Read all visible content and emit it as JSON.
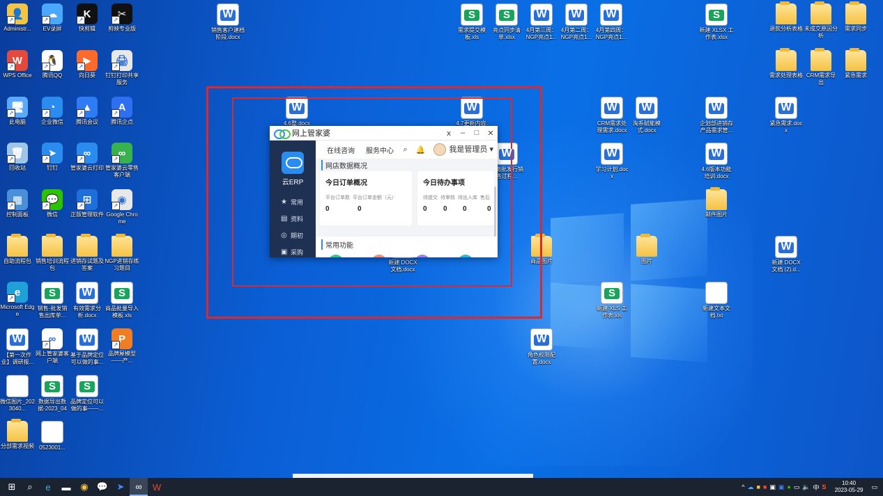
{
  "desktop": {
    "icons": [
      {
        "label": "Administr...",
        "kind": "app",
        "glyph": "👤",
        "color": "#f4c542"
      },
      {
        "label": "EV录屏",
        "kind": "app",
        "glyph": "☁",
        "color": "#4aa8ff"
      },
      {
        "label": "快剪辑",
        "kind": "app",
        "glyph": "K",
        "color": "#111111"
      },
      {
        "label": "剪映专业版",
        "kind": "app",
        "glyph": "✂",
        "color": "#111111"
      },
      {
        "label": "WPS Office",
        "kind": "app",
        "glyph": "W",
        "color": "#e24a3b"
      },
      {
        "label": "腾讯QQ",
        "kind": "app",
        "glyph": "🐧",
        "color": "#ffffff"
      },
      {
        "label": "向日葵",
        "kind": "app",
        "glyph": "▶",
        "color": "#ff6a2b"
      },
      {
        "label": "钉钉打印共享服务",
        "kind": "app",
        "glyph": "🖨",
        "color": "#e8e8e8"
      },
      {
        "label": "此电脑",
        "kind": "app",
        "glyph": "🖥",
        "color": "#5aa9ff"
      },
      {
        "label": "企业微信",
        "kind": "app",
        "glyph": "◔",
        "color": "#2b8cf0"
      },
      {
        "label": "腾讯会议",
        "kind": "app",
        "glyph": "▲",
        "color": "#2f7bf6"
      },
      {
        "label": "腾讯企点",
        "kind": "app",
        "glyph": "A",
        "color": "#2d6ff0"
      },
      {
        "label": "回收站",
        "kind": "app",
        "glyph": "🗑",
        "color": "#9fc6e8"
      },
      {
        "label": "钉钉",
        "kind": "app",
        "glyph": "➤",
        "color": "#2b8cf0"
      },
      {
        "label": "管家婆云打印",
        "kind": "app",
        "glyph": "∞",
        "color": "#2b8cf0"
      },
      {
        "label": "管家婆云零售客户端",
        "kind": "app",
        "glyph": "∞",
        "color": "#37b24d"
      },
      {
        "label": "控制面板",
        "kind": "app",
        "glyph": "▦",
        "color": "#4a90d9"
      },
      {
        "label": "微信",
        "kind": "app",
        "glyph": "💬",
        "color": "#2dc100"
      },
      {
        "label": "正版管理软件",
        "kind": "app",
        "glyph": "⊞",
        "color": "#1e6fd9"
      },
      {
        "label": "Google Chrome",
        "kind": "app",
        "glyph": "◉",
        "color": "#e8e8e8"
      },
      {
        "label": "自助流程包",
        "kind": "folder"
      },
      {
        "label": "销售培训流程包",
        "kind": "folder"
      },
      {
        "label": "进销存试题及答案",
        "kind": "folder"
      },
      {
        "label": "NGP进销存练习题目",
        "kind": "folder"
      },
      {
        "label": "Microsoft Edge",
        "kind": "app",
        "glyph": "e",
        "color": "#1fa0d8"
      },
      {
        "label": "销售-批发销售出库单...",
        "kind": "xls"
      },
      {
        "label": "有效需求分析.docx",
        "kind": "word"
      },
      {
        "label": "商品批量导入模板.xls",
        "kind": "xls"
      },
      {
        "label": "【第一次作业】调研报...",
        "kind": "word"
      },
      {
        "label": "网上管家婆客户端",
        "kind": "app",
        "glyph": "∞",
        "color": "#ffffff"
      },
      {
        "label": "基于品牌定位可以做的事...",
        "kind": "word"
      },
      {
        "label": "品牌屋模型——产...",
        "kind": "app",
        "glyph": "P",
        "color": "#f07c24"
      },
      {
        "label": "微信图片_2023040...",
        "kind": "txt"
      },
      {
        "label": "数据导出数据-2023_04_...",
        "kind": "xls"
      },
      {
        "label": "品牌定位可以做的事——...",
        "kind": "xls"
      },
      {
        "label": "分部需求视频",
        "kind": "folder"
      },
      {
        "label": "0523001...",
        "kind": "txt"
      },
      {
        "label": "销售客户建档阶段.docx",
        "kind": "word"
      },
      {
        "label": "需求提交模板.xls",
        "kind": "xls"
      },
      {
        "label": "亮点同步清单.xlsx",
        "kind": "xls"
      },
      {
        "label": "4月第三周：NGP亮点1...",
        "kind": "word"
      },
      {
        "label": "4月第二周：NGP亮点1...",
        "kind": "word"
      },
      {
        "label": "4月第四周：NGP亮点1...",
        "kind": "word"
      },
      {
        "label": "新建 XLSX 工作表.xlsx",
        "kind": "xls"
      },
      {
        "label": "退款分析表格",
        "kind": "folder"
      },
      {
        "label": "未成交原因分析",
        "kind": "folder"
      },
      {
        "label": "需求同步",
        "kind": "folder"
      },
      {
        "label": "需求处理表格",
        "kind": "folder"
      },
      {
        "label": "CRM需求导出",
        "kind": "folder"
      },
      {
        "label": "紧急需求",
        "kind": "folder"
      },
      {
        "label": "4.6整.docx",
        "kind": "word"
      },
      {
        "label": "4.7更新内容.",
        "kind": "word"
      },
      {
        "label": "CRM需求处理需求.docx",
        "kind": "word"
      },
      {
        "label": "淘系赋能模式.docx",
        "kind": "word"
      },
      {
        "label": "企划部进销存产品需求管...",
        "kind": "word"
      },
      {
        "label": "紧急需求.docx",
        "kind": "word"
      },
      {
        "label": "淘电批发行销售过程...",
        "kind": "word"
      },
      {
        "label": "学习计划.docx",
        "kind": "word"
      },
      {
        "label": "4.6版本功能培训.docx",
        "kind": "word"
      },
      {
        "label": "邮件图片",
        "kind": "folder"
      },
      {
        "label": "新建 DOCX 文档.docx",
        "kind": "word"
      },
      {
        "label": "商品图片",
        "kind": "folder"
      },
      {
        "label": "图片",
        "kind": "folder"
      },
      {
        "label": "新建 DOCX 文档 (2).d...",
        "kind": "word"
      },
      {
        "label": "新建 XLS 工作表.xls",
        "kind": "xls"
      },
      {
        "label": "新建文本文档.txt",
        "kind": "txt"
      },
      {
        "label": "角色权限配置.docx",
        "kind": "word"
      }
    ]
  },
  "erp_window": {
    "title": "网上管家婆",
    "controls": {
      "pin": "ⅹ",
      "minimize": "–",
      "maximize": "□",
      "close": "✕"
    },
    "brand_label": "云ERP",
    "nav": [
      {
        "icon": "★",
        "label": "常用"
      },
      {
        "icon": "▤",
        "label": "资料"
      },
      {
        "icon": "◎",
        "label": "期初"
      },
      {
        "icon": "▣",
        "label": "采购"
      }
    ],
    "top_tabs": [
      "在线咨询",
      "服务中心"
    ],
    "user_label": "我是管理员",
    "section_overview": "网店数据概况",
    "card_orders": {
      "title": "今日订单概况",
      "cols": [
        "平台订单数",
        "平台订单金额（元）"
      ],
      "nums": [
        "0",
        "0"
      ]
    },
    "card_todo": {
      "title": "今日待办事项",
      "cols": [
        "待提交",
        "待审核",
        "待出入库",
        "售后"
      ],
      "nums": [
        "0",
        "0",
        "0",
        "0"
      ]
    },
    "section_common": "常用功能"
  },
  "taskbar": {
    "apps": [
      {
        "name": "start",
        "glyph": "⊞"
      },
      {
        "name": "search",
        "glyph": "⌕"
      },
      {
        "name": "edge",
        "glyph": "e"
      },
      {
        "name": "explorer",
        "glyph": "▬"
      },
      {
        "name": "chrome",
        "glyph": "◉"
      },
      {
        "name": "wechat",
        "glyph": "💬"
      },
      {
        "name": "dingtalk",
        "glyph": "➤"
      },
      {
        "name": "guanjiapo",
        "glyph": "∞"
      },
      {
        "name": "wps",
        "glyph": "W"
      }
    ],
    "tray_ime": "中",
    "time": "10:40",
    "date": "2023-05-29"
  }
}
